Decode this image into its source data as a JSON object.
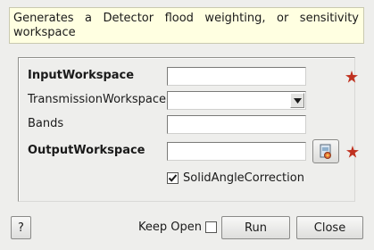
{
  "description": "Generates a Detector flood weighting, or sensitivity workspace",
  "fields": {
    "input_workspace": {
      "label": "InputWorkspace",
      "value": ""
    },
    "transmission_workspace": {
      "label": "TransmissionWorkspace",
      "value": ""
    },
    "bands": {
      "label": "Bands",
      "value": ""
    },
    "output_workspace": {
      "label": "OutputWorkspace",
      "value": ""
    }
  },
  "solid_angle_correction": {
    "label": "SolidAngleCorrection",
    "checked": true
  },
  "footer": {
    "help_label": "?",
    "keep_open_label": "Keep Open",
    "keep_open_checked": false,
    "run_label": "Run",
    "close_label": "Close"
  },
  "colors": {
    "required_star": "#c0311f",
    "description_bg": "#ffffe1"
  },
  "icons": {
    "required": "required-star-icon",
    "browse": "workspace-browse-icon",
    "dropdown": "chevron-down-icon",
    "check": "checkmark-icon"
  }
}
